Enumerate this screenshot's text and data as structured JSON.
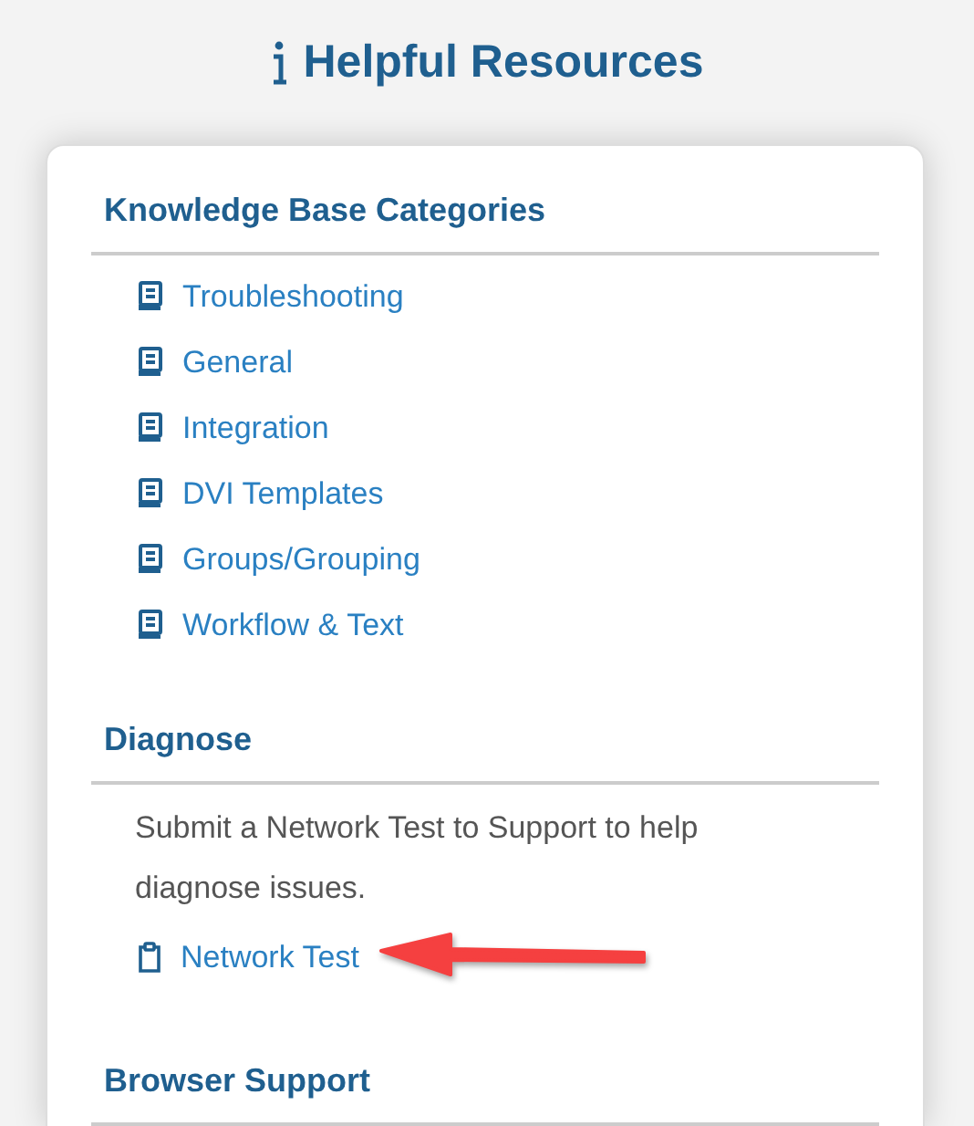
{
  "title": "Helpful Resources",
  "sections": [
    {
      "heading": "Knowledge Base Categories",
      "links": [
        {
          "label": "Troubleshooting",
          "kind": "book"
        },
        {
          "label": "General",
          "kind": "book"
        },
        {
          "label": "Integration",
          "kind": "book"
        },
        {
          "label": "DVI Templates",
          "kind": "book"
        },
        {
          "label": "Groups/Grouping",
          "kind": "book"
        },
        {
          "label": "Workflow & Text",
          "kind": "book"
        }
      ]
    },
    {
      "heading": "Diagnose",
      "description": "Submit a Network Test to Support to help diagnose issues.",
      "links": [
        {
          "label": "Network Test",
          "kind": "clipboard",
          "annotated": true
        }
      ]
    },
    {
      "heading": "Browser Support"
    }
  ]
}
